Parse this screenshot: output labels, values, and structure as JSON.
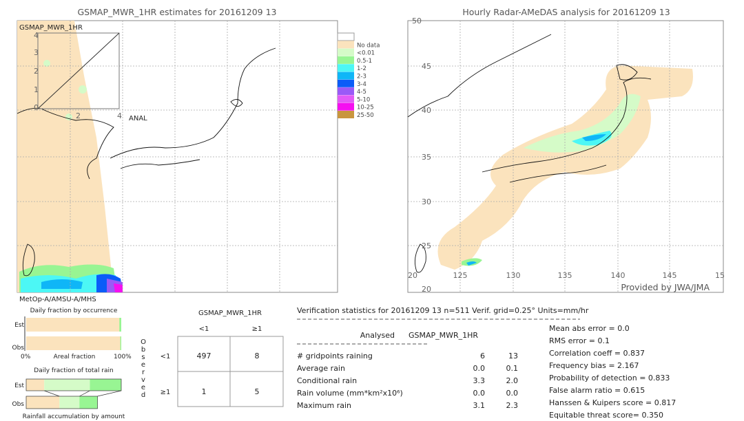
{
  "left_map": {
    "title": "GSMAP_MWR_1HR estimates for 20161209 13",
    "label": "GSMAP_MWR_1HR",
    "inset_label": "ANAL",
    "inset_ticks": [
      "0",
      "1",
      "2",
      "3",
      "4"
    ],
    "inset_xticks": [
      "2",
      "4"
    ],
    "sensor": "MetOp-A/AMSU-A/MHS"
  },
  "right_map": {
    "title": "Hourly Radar-AMeDAS analysis for 20161209 13",
    "lat_ticks": [
      "50",
      "45",
      "40",
      "35",
      "30",
      "25",
      "20"
    ],
    "lon_ticks": [
      "20",
      "125",
      "130",
      "135",
      "140",
      "145",
      "15"
    ],
    "credit": "Provided by JWA/JMA"
  },
  "legend": [
    {
      "label": "",
      "color": "#ffffff"
    },
    {
      "label": "No data",
      "color": "#fbe3bd"
    },
    {
      "label": "<0.01",
      "color": "#d5fbc8"
    },
    {
      "label": "0.5-1",
      "color": "#98f593"
    },
    {
      "label": "1-2",
      "color": "#4cf7f5"
    },
    {
      "label": "2-3",
      "color": "#0fb6f7"
    },
    {
      "label": "3-4",
      "color": "#0b5cf8"
    },
    {
      "label": "4-5",
      "color": "#9a5af7"
    },
    {
      "label": "5-10",
      "color": "#e25af6"
    },
    {
      "label": "10-25",
      "color": "#f50ff0"
    },
    {
      "label": "25-50",
      "color": "#c9963e"
    }
  ],
  "fraction_panel": {
    "title1": "Daily fraction by occurrence",
    "est": "Est",
    "obs": "Obs",
    "axis_left": "0%",
    "axis_mid": "Areal fraction",
    "axis_right": "100%",
    "title2": "Daily fraction of total rain",
    "footer": "Rainfall accumulation by amount",
    "occurrence_est_rain_fraction": 0.02,
    "occurrence_obs_rain_fraction": 0.01,
    "total_rain_est": [
      0.19,
      0.48,
      0.33
    ],
    "total_rain_obs": [
      0.35,
      0.21,
      0.19
    ]
  },
  "contingency": {
    "title": "GSMAP_MWR_1HR",
    "col_labels": [
      "<1",
      "≥1"
    ],
    "row_labels": [
      "<1",
      "≥1"
    ],
    "side_label": [
      "O",
      "b",
      "s",
      "e",
      "r",
      "v",
      "e",
      "d"
    ],
    "cells": [
      [
        "497",
        "8"
      ],
      [
        "1",
        "5"
      ]
    ]
  },
  "stats": {
    "header": "Verification statistics for 20161209 13  n=511  Verif. grid=0.25°  Units=mm/hr",
    "col_a": "Analysed",
    "col_b": "GSMAP_MWR_1HR",
    "rows": [
      {
        "label": "# gridpoints raining",
        "a": "6",
        "b": "13"
      },
      {
        "label": "Average rain",
        "a": "0.0",
        "b": "0.1"
      },
      {
        "label": "Conditional rain",
        "a": "3.3",
        "b": "2.0"
      },
      {
        "label": "Rain volume (mm*km²x10⁶)",
        "a": "0.0",
        "b": "0.0"
      },
      {
        "label": "Maximum rain",
        "a": "3.1",
        "b": "2.3"
      }
    ],
    "scores": [
      "Mean abs error = 0.0",
      "RMS error = 0.1",
      "Correlation coeff = 0.837",
      "Frequency bias = 2.167",
      "Probability of detection = 0.833",
      "False alarm ratio = 0.615",
      "Hanssen & Kuipers score = 0.817",
      "Equitable threat score= 0.350"
    ]
  },
  "chart_data": {
    "type": "table",
    "contingency_table": {
      "rows": [
        "obs <1",
        "obs ≥1"
      ],
      "cols": [
        "est <1",
        "est ≥1"
      ],
      "values": [
        [
          497,
          8
        ],
        [
          1,
          5
        ]
      ]
    },
    "analysed": {
      "gridpoints_raining": 6,
      "average_rain": 0.0,
      "conditional_rain": 3.3,
      "rain_volume": 0.0,
      "maximum_rain": 3.1
    },
    "gsmap": {
      "gridpoints_raining": 13,
      "average_rain": 0.1,
      "conditional_rain": 2.0,
      "rain_volume": 0.0,
      "maximum_rain": 2.3
    }
  }
}
